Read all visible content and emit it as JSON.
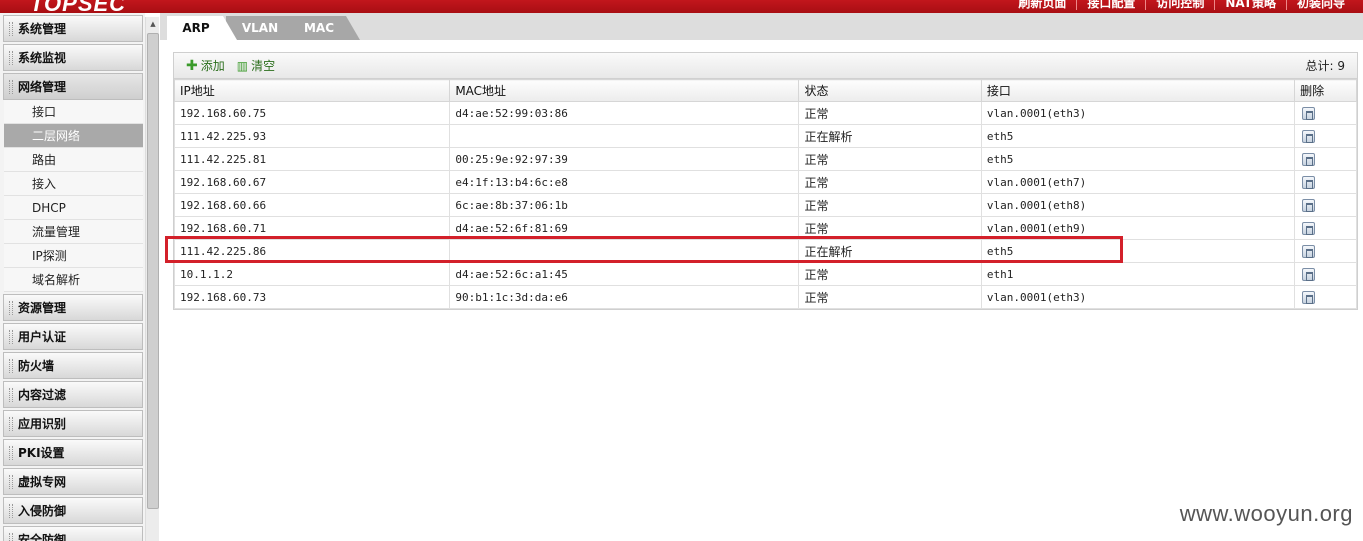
{
  "header": {
    "logo_text": "TOPSEC",
    "links": [
      "刷新页面",
      "接口配置",
      "访问控制",
      "NAT策略",
      "初装向导"
    ]
  },
  "sidebar": {
    "sections": [
      {
        "label": "系统管理"
      },
      {
        "label": "系统监视"
      },
      {
        "label": "网络管理"
      }
    ],
    "sub_items": [
      "接口",
      "二层网络",
      "路由",
      "接入",
      "DHCP",
      "流量管理",
      "IP探测",
      "域名解析"
    ],
    "selected_sub": "二层网络",
    "sections_after": [
      "资源管理",
      "用户认证",
      "防火墙",
      "内容过滤",
      "应用识别",
      "PKI设置",
      "虚拟专网",
      "入侵防御",
      "安全防御"
    ]
  },
  "tabs": [
    "ARP",
    "VLAN",
    "MAC"
  ],
  "active_tab": "ARP",
  "toolbar": {
    "add_label": "添加",
    "clear_label": "清空",
    "total_text": "总计: 9"
  },
  "table": {
    "headers": [
      "IP地址",
      "MAC地址",
      "状态",
      "接口",
      "删除"
    ],
    "rows": [
      [
        "192.168.60.75",
        "d4:ae:52:99:03:86",
        "正常",
        "vlan.0001(eth3)"
      ],
      [
        "111.42.225.93",
        "",
        "正在解析",
        "eth5"
      ],
      [
        "111.42.225.81",
        "00:25:9e:92:97:39",
        "正常",
        "eth5"
      ],
      [
        "192.168.60.67",
        "e4:1f:13:b4:6c:e8",
        "正常",
        "vlan.0001(eth7)"
      ],
      [
        "192.168.60.66",
        "6c:ae:8b:37:06:1b",
        "正常",
        "vlan.0001(eth8)"
      ],
      [
        "192.168.60.71",
        "d4:ae:52:6f:81:69",
        "正常",
        "vlan.0001(eth9)"
      ],
      [
        "111.42.225.86",
        "",
        "正在解析",
        "eth5"
      ],
      [
        "10.1.1.2",
        "d4:ae:52:6c:a1:45",
        "正常",
        "eth1"
      ],
      [
        "192.168.60.73",
        "90:b1:1c:3d:da:e6",
        "正常",
        "vlan.0001(eth3)"
      ]
    ],
    "highlighted_row_index": 6,
    "highlight_color": "#d3202a"
  },
  "watermark": "www.wooyun.org"
}
